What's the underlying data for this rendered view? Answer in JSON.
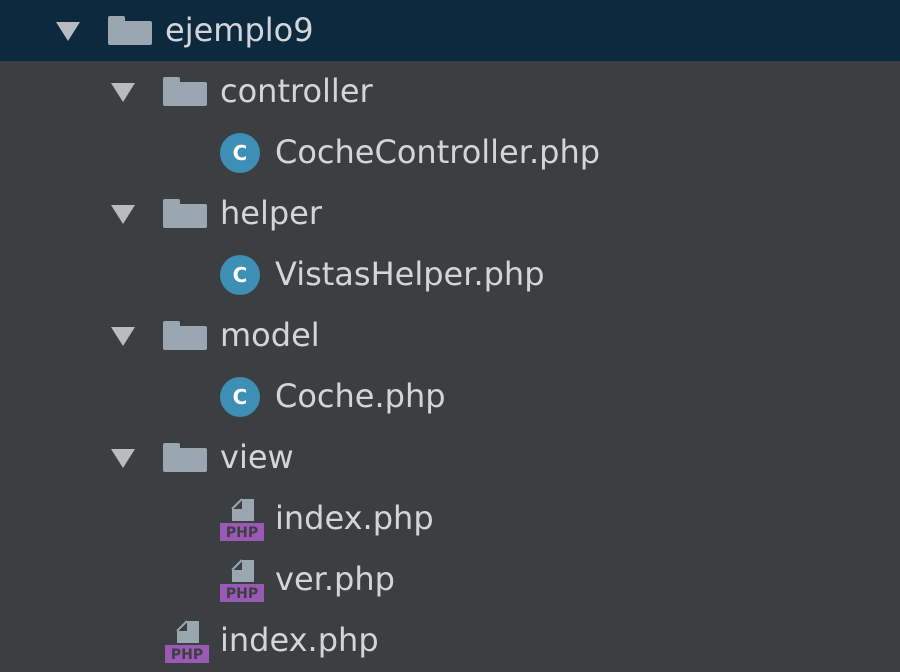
{
  "tree": {
    "root": {
      "label": "ejemplo9",
      "icon": "folder-icon",
      "expanded": true,
      "selected": true,
      "children": [
        {
          "label": "controller",
          "icon": "folder-icon",
          "expanded": true,
          "children": [
            {
              "label": "CocheController.php",
              "icon": "php-class-icon",
              "icon_text": "C"
            }
          ]
        },
        {
          "label": "helper",
          "icon": "folder-icon",
          "expanded": true,
          "children": [
            {
              "label": "VistasHelper.php",
              "icon": "php-class-icon",
              "icon_text": "C"
            }
          ]
        },
        {
          "label": "model",
          "icon": "folder-icon",
          "expanded": true,
          "children": [
            {
              "label": "Coche.php",
              "icon": "php-class-icon",
              "icon_text": "C"
            }
          ]
        },
        {
          "label": "view",
          "icon": "folder-icon",
          "expanded": true,
          "children": [
            {
              "label": "index.php",
              "icon": "php-file-icon",
              "icon_text": "PHP"
            },
            {
              "label": "ver.php",
              "icon": "php-file-icon",
              "icon_text": "PHP"
            }
          ]
        },
        {
          "label": "index.php",
          "icon": "php-file-icon",
          "icon_text": "PHP"
        }
      ]
    }
  },
  "colors": {
    "background": "#3c3f41",
    "selected_row": "#0d293e",
    "text": "#d3d6d9",
    "folder": "#9aa7b0",
    "class_icon": "#3d8fb5",
    "php_badge": "#9b59b6"
  }
}
